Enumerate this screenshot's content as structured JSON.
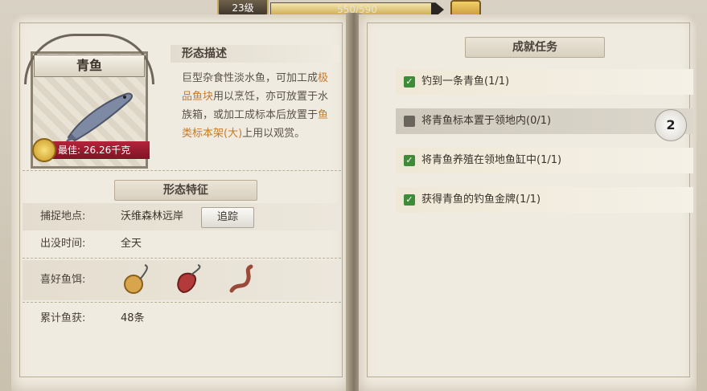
{
  "header": {
    "level_label": "23级",
    "xp_text": "550/590",
    "xp_fraction": 0.932,
    "chest_icon": "treasure-chest-icon"
  },
  "fish_card": {
    "name": "青鱼",
    "best_label": "最佳: 26.26千克",
    "medal_icon": "gold-medal-icon",
    "fish_icon": "fish-icon"
  },
  "description": {
    "title": "形态描述",
    "text_parts": [
      {
        "t": "巨型杂食性淡水鱼，可加工成",
        "hl": false
      },
      {
        "t": "极品鱼块",
        "hl": true
      },
      {
        "t": "用以烹饪，亦可放置于水族箱，或加工成标本后放置于",
        "hl": false
      },
      {
        "t": "鱼类标本架(大)",
        "hl": true
      },
      {
        "t": "上用以观赏。",
        "hl": false
      }
    ],
    "highlight_color": "#c77a2b"
  },
  "features": {
    "title": "形态特征",
    "location_label": "捕捉地点:",
    "location_value": "沃维森林远岸",
    "track_button": "追踪",
    "time_label": "出没时间:",
    "time_value": "全天",
    "bait_label": "喜好鱼饵:",
    "baits": [
      "bread-ball-bait-icon",
      "meat-chunk-bait-icon",
      "worm-bait-icon"
    ],
    "catch_label": "累计鱼获:",
    "catch_value": "48条"
  },
  "achievements": {
    "title": "成就任务",
    "tasks": [
      {
        "label": "钓到一条青鱼(1/1)",
        "done": true
      },
      {
        "label": "将青鱼标本置于领地内(0/1)",
        "done": false
      },
      {
        "label": "将青鱼养殖在领地鱼缸中(1/1)",
        "done": true
      },
      {
        "label": "获得青鱼的钓鱼金牌(1/1)",
        "done": true
      }
    ],
    "pin_badge": "2"
  }
}
